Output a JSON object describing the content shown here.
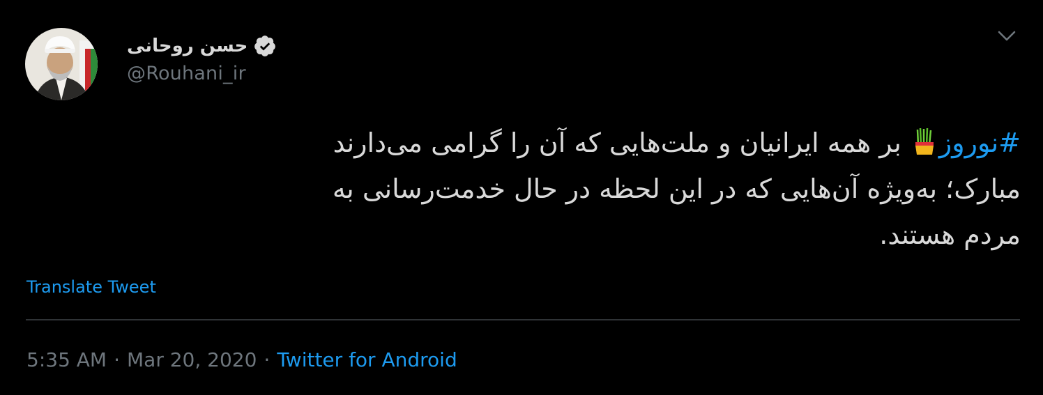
{
  "tweet": {
    "user": {
      "display_name": "حسن روحانی",
      "handle": "@Rouhani_ir",
      "verified": true
    },
    "text": {
      "hashtag": "#نوروز",
      "emoji": "sabzeh",
      "line1": "بر همه ایرانیان و ملت‌هایی که آن را گرامی می‌دارند",
      "line2": "مبارک؛ به‌ویژه آن‌هایی که در این لحظه در حال خدمت‌رسانی به",
      "line3": "مردم هستند."
    },
    "translate_label": "Translate Tweet",
    "time": "5:35 AM",
    "separator": "·",
    "date": "Mar 20, 2020",
    "source": "Twitter for Android"
  },
  "icons": {
    "caret": "chevron-down-icon",
    "verified": "verified-badge-icon"
  },
  "colors": {
    "background": "#000000",
    "text": "#d9d9d9",
    "secondary": "#6e767d",
    "accent": "#1d9bf0",
    "divider": "#2f3336"
  }
}
